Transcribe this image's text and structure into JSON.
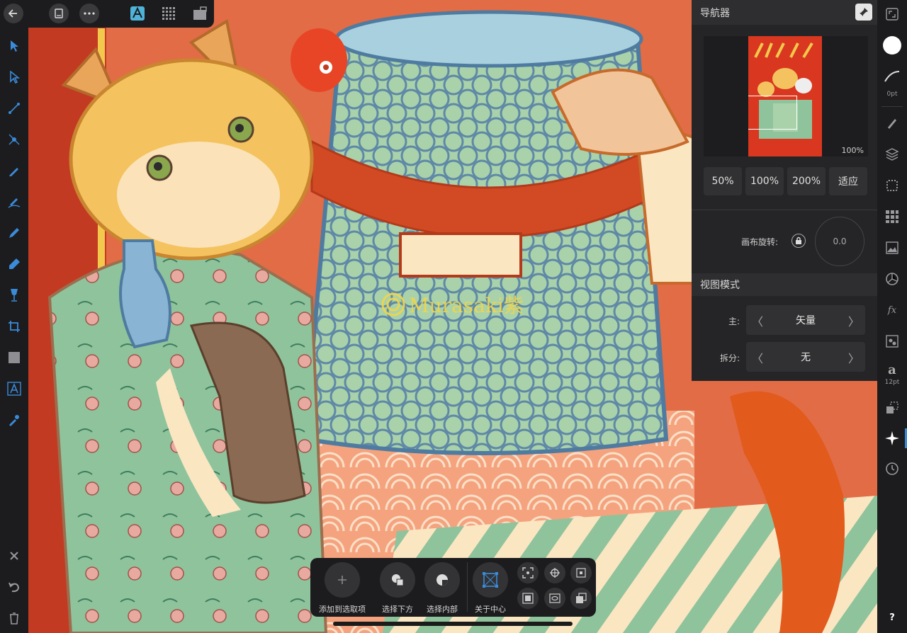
{
  "navigator": {
    "title": "导航器",
    "thumbnail_zoom": "100%",
    "zoom_buttons": [
      "50%",
      "100%",
      "200%",
      "适应"
    ],
    "rotation_label": "画布旋转:",
    "rotation_value": "0.0"
  },
  "view_mode": {
    "title": "视图模式",
    "primary_label": "主:",
    "primary_value": "矢量",
    "split_label": "拆分:",
    "split_value": "无"
  },
  "right_bar": {
    "stroke_width": "0pt",
    "font_size": "12pt"
  },
  "context_toolbar": {
    "items": [
      {
        "label": "添加到选取项"
      },
      {
        "label": "选择下方"
      },
      {
        "label": "选择内部"
      },
      {
        "label": "关于中心"
      }
    ]
  },
  "watermark": {
    "text": "Murasaki紫"
  },
  "colors": {
    "panel_bg": "#252527",
    "toolbar_bg": "#1c1c1e",
    "accent_blue": "#3a8bd9",
    "fill_swatch": "#ffffff"
  }
}
